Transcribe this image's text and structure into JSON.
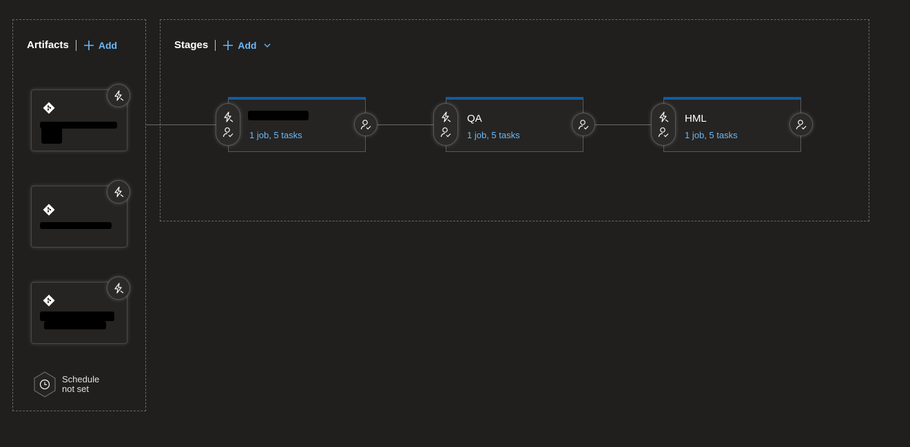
{
  "artifacts": {
    "title": "Artifacts",
    "add_label": "Add",
    "items": [
      {
        "name_redacted": true,
        "icon": "git-icon"
      },
      {
        "name_redacted": true,
        "icon": "git-icon"
      },
      {
        "name_redacted": true,
        "icon": "git-icon"
      }
    ],
    "schedule": {
      "line1": "Schedule",
      "line2": "not set",
      "icon": "clock-icon"
    }
  },
  "stages": {
    "title": "Stages",
    "add_label": "Add",
    "items": [
      {
        "name": "",
        "name_redacted": true,
        "detail": "1 job, 5 tasks"
      },
      {
        "name": "QA",
        "detail": "1 job, 5 tasks"
      },
      {
        "name": "HML",
        "detail": "1 job, 5 tasks"
      }
    ]
  },
  "colors": {
    "background": "#201f1e",
    "accent_link": "#6cb8f6",
    "stage_top_bar": "#0f5ca8",
    "card_bg": "#252423"
  }
}
